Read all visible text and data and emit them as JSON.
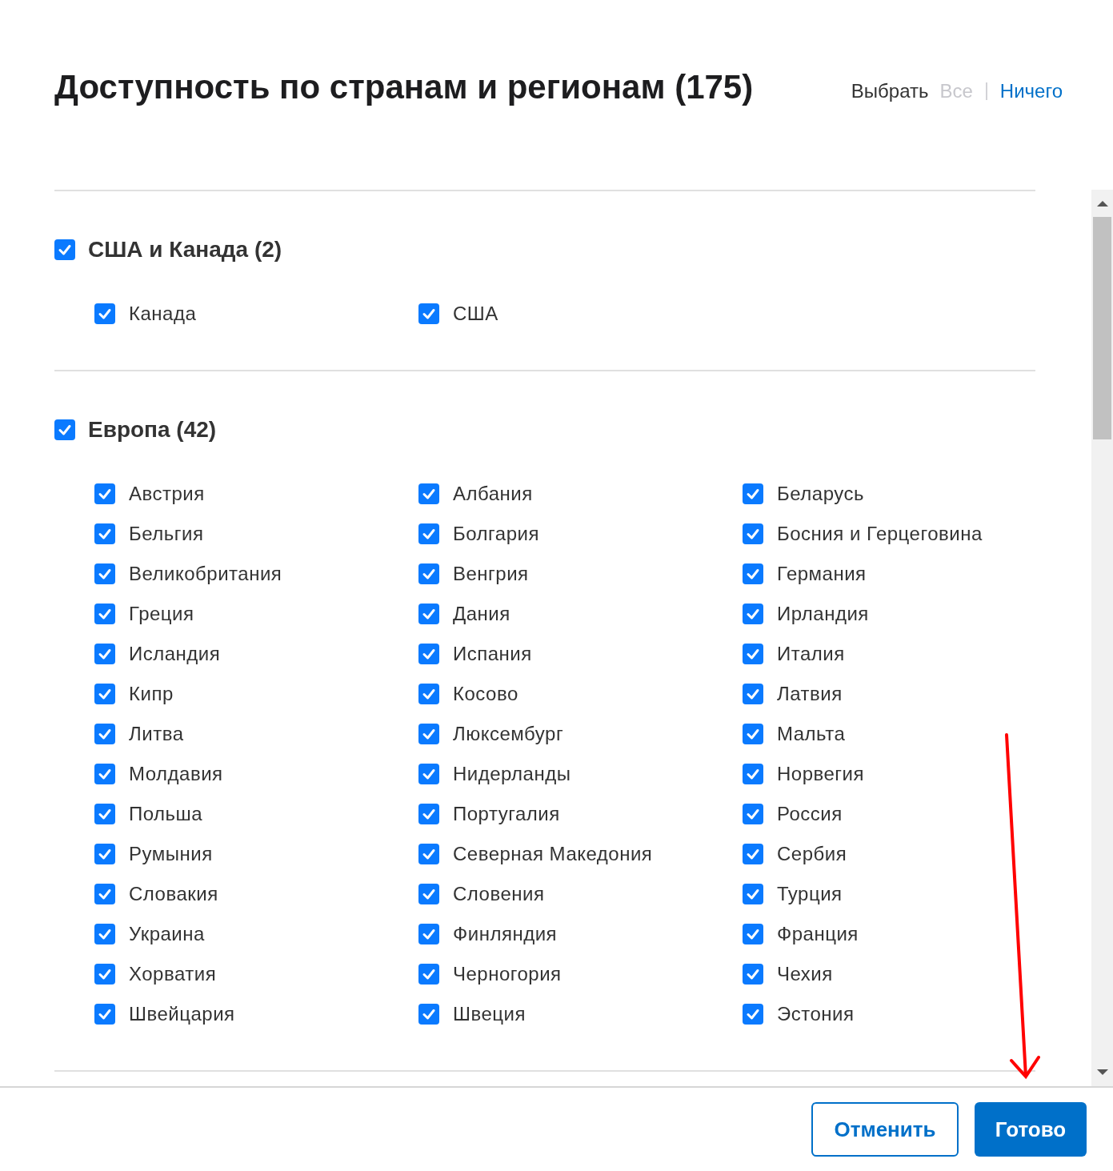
{
  "dialog": {
    "title": "Доступность по странам и регионам (175)",
    "select": {
      "label": "Выбрать",
      "options": [
        {
          "label": "Все",
          "disabled": true
        },
        {
          "label": "Ничего",
          "disabled": false
        }
      ]
    },
    "groups": [
      {
        "title": "США и Канада (2)",
        "checked": true,
        "items": [
          {
            "label": "Канада",
            "checked": true
          },
          {
            "label": "США",
            "checked": true
          }
        ]
      },
      {
        "title": "Европа (42)",
        "checked": true,
        "items": [
          {
            "label": "Австрия",
            "checked": true
          },
          {
            "label": "Албания",
            "checked": true
          },
          {
            "label": "Беларусь",
            "checked": true
          },
          {
            "label": "Бельгия",
            "checked": true
          },
          {
            "label": "Болгария",
            "checked": true
          },
          {
            "label": "Босния и Герцеговина",
            "checked": true
          },
          {
            "label": "Великобритания",
            "checked": true
          },
          {
            "label": "Венгрия",
            "checked": true
          },
          {
            "label": "Германия",
            "checked": true
          },
          {
            "label": "Греция",
            "checked": true
          },
          {
            "label": "Дания",
            "checked": true
          },
          {
            "label": "Ирландия",
            "checked": true
          },
          {
            "label": "Исландия",
            "checked": true
          },
          {
            "label": "Испания",
            "checked": true
          },
          {
            "label": "Италия",
            "checked": true
          },
          {
            "label": "Кипр",
            "checked": true
          },
          {
            "label": "Косово",
            "checked": true
          },
          {
            "label": "Латвия",
            "checked": true
          },
          {
            "label": "Литва",
            "checked": true
          },
          {
            "label": "Люксембург",
            "checked": true
          },
          {
            "label": "Мальта",
            "checked": true
          },
          {
            "label": "Молдавия",
            "checked": true
          },
          {
            "label": "Нидерланды",
            "checked": true
          },
          {
            "label": "Норвегия",
            "checked": true
          },
          {
            "label": "Польша",
            "checked": true
          },
          {
            "label": "Португалия",
            "checked": true
          },
          {
            "label": "Россия",
            "checked": true
          },
          {
            "label": "Румыния",
            "checked": true
          },
          {
            "label": "Северная Македония",
            "checked": true
          },
          {
            "label": "Сербия",
            "checked": true
          },
          {
            "label": "Словакия",
            "checked": true
          },
          {
            "label": "Словения",
            "checked": true
          },
          {
            "label": "Турция",
            "checked": true
          },
          {
            "label": "Украина",
            "checked": true
          },
          {
            "label": "Финляндия",
            "checked": true
          },
          {
            "label": "Франция",
            "checked": true
          },
          {
            "label": "Хорватия",
            "checked": true
          },
          {
            "label": "Черногория",
            "checked": true
          },
          {
            "label": "Чехия",
            "checked": true
          },
          {
            "label": "Швейцария",
            "checked": true
          },
          {
            "label": "Швеция",
            "checked": true
          },
          {
            "label": "Эстония",
            "checked": true
          }
        ]
      }
    ],
    "buttons": [
      {
        "label": "Отменить",
        "kind": "secondary"
      },
      {
        "label": "Готово",
        "kind": "primary"
      }
    ]
  }
}
